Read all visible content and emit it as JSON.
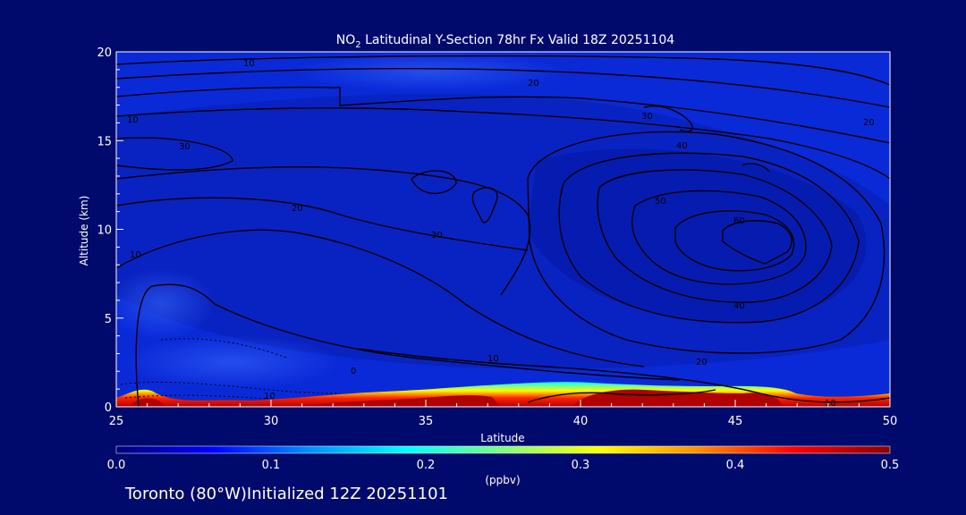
{
  "colors": {
    "background": "#000a6c",
    "plot_base": "#0a2ad8",
    "high_concentration": "#b80000",
    "contour": "#000000"
  },
  "footer": {
    "text": "Toronto (80°W)Initialized 12Z 20251101"
  },
  "chart_data": {
    "type": "heatmap",
    "title_prefix": "NO",
    "title_sub": "2",
    "title_rest": " Latitudinal Y-Section 78hr  Fx Valid 18Z 20251104",
    "xlabel": "Latitude",
    "ylabel": "Altitude (km)",
    "xlim": [
      25,
      50
    ],
    "ylim": [
      0,
      20
    ],
    "xticks": [
      25,
      30,
      35,
      40,
      45,
      50
    ],
    "yticks": [
      0,
      5,
      10,
      15,
      20
    ],
    "grid": false,
    "colorbar": {
      "label": "(ppbv)",
      "range": [
        0.0,
        0.5
      ],
      "ticks": [
        "0.0",
        "0.1",
        "0.2",
        "0.3",
        "0.4",
        "0.5"
      ],
      "stops": [
        "#00007a",
        "#0000ff",
        "#0090ff",
        "#00ffff",
        "#80ff80",
        "#ffff00",
        "#ff9000",
        "#ff0000",
        "#8a0000"
      ]
    },
    "surface_layer": {
      "description_values": [
        {
          "lat": 26,
          "alt": 0.3,
          "value": 0.5
        },
        {
          "lat": 33,
          "alt": 0.3,
          "value": 0.5
        },
        {
          "lat": 36,
          "alt": 0.5,
          "value": 0.5
        },
        {
          "lat": 41,
          "alt": 0.6,
          "value": 0.5
        },
        {
          "lat": 45,
          "alt": 0.4,
          "value": 0.5
        }
      ]
    },
    "contour_labels": [
      "10",
      "20",
      "30",
      "40",
      "50",
      "60",
      "10",
      "20",
      "30",
      "40",
      "10",
      "20",
      "10",
      "0",
      "10",
      "10",
      "20",
      "30"
    ]
  }
}
